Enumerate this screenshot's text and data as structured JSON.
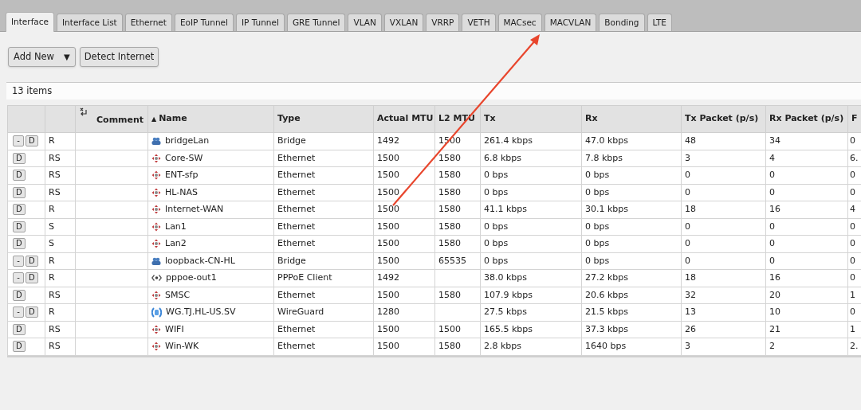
{
  "tabs": [
    {
      "label": "Interface",
      "selected": true
    },
    {
      "label": "Interface List",
      "selected": false
    },
    {
      "label": "Ethernet",
      "selected": false
    },
    {
      "label": "EoIP Tunnel",
      "selected": false
    },
    {
      "label": "IP Tunnel",
      "selected": false
    },
    {
      "label": "GRE Tunnel",
      "selected": false
    },
    {
      "label": "VLAN",
      "selected": false
    },
    {
      "label": "VXLAN",
      "selected": false
    },
    {
      "label": "VRRP",
      "selected": false
    },
    {
      "label": "VETH",
      "selected": false
    },
    {
      "label": "MACsec",
      "selected": false
    },
    {
      "label": "MACVLAN",
      "selected": false
    },
    {
      "label": "Bonding",
      "selected": false
    },
    {
      "label": "LTE",
      "selected": false
    }
  ],
  "toolbar": {
    "add_button": {
      "label": "Add New",
      "caret": "▼"
    },
    "detect_button": {
      "label": "Detect Internet"
    }
  },
  "item_count": "13 items",
  "table": {
    "columns": [
      "",
      "",
      "Comment",
      "Name",
      "Type",
      "Actual MTU",
      "L2 MTU",
      "Tx",
      "Rx",
      "Tx Packet (p/s)",
      "Rx Packet (p/s)",
      "F"
    ],
    "sort_mark": "▲",
    "rows": [
      {
        "buttons": [
          "-",
          "D"
        ],
        "flags": "R",
        "comment": "",
        "kind": "bridge",
        "name": "bridgeLan",
        "type": "Bridge",
        "actual_mtu": "1492",
        "l2_mtu": "1500",
        "tx": "261.4 kbps",
        "rx": "47.0 kbps",
        "tx_packet": "48",
        "rx_packet": "34",
        "column_12": "0"
      },
      {
        "buttons": [
          "D"
        ],
        "flags": "RS",
        "kind": "ethernet",
        "name": "Core-SW",
        "type": "Ethernet",
        "actual_mtu": "1500",
        "l2_mtu": "1580",
        "tx": "6.8 kbps",
        "rx": "7.8 kbps",
        "tx_packet": "3",
        "rx_packet": "4",
        "column_12": "6."
      },
      {
        "buttons": [
          "D"
        ],
        "flags": "RS",
        "kind": "ethernet",
        "name": "ENT-sfp",
        "type": "Ethernet",
        "actual_mtu": "1500",
        "l2_mtu": "1580",
        "tx": "0 bps",
        "rx": "0 bps",
        "tx_packet": "0",
        "rx_packet": "0",
        "column_12": "0"
      },
      {
        "buttons": [
          "D"
        ],
        "flags": "RS",
        "kind": "ethernet",
        "name": "HL-NAS",
        "type": "Ethernet",
        "actual_mtu": "1500",
        "l2_mtu": "1580",
        "tx": "0 bps",
        "rx": "0 bps",
        "tx_packet": "0",
        "rx_packet": "0",
        "column_12": "0"
      },
      {
        "buttons": [
          "D"
        ],
        "flags": "R",
        "kind": "ethernet",
        "name": "Internet-WAN",
        "type": "Ethernet",
        "actual_mtu": "1500",
        "l2_mtu": "1580",
        "tx": "41.1 kbps",
        "rx": "30.1 kbps",
        "tx_packet": "18",
        "rx_packet": "16",
        "column_12": "4"
      },
      {
        "buttons": [
          "D"
        ],
        "flags": "S",
        "kind": "ethernet",
        "name": "Lan1",
        "type": "Ethernet",
        "actual_mtu": "1500",
        "l2_mtu": "1580",
        "tx": "0 bps",
        "rx": "0 bps",
        "tx_packet": "0",
        "rx_packet": "0",
        "column_12": "0"
      },
      {
        "buttons": [
          "D"
        ],
        "flags": "S",
        "kind": "ethernet",
        "name": "Lan2",
        "type": "Ethernet",
        "actual_mtu": "1500",
        "l2_mtu": "1580",
        "tx": "0 bps",
        "rx": "0 bps",
        "tx_packet": "0",
        "rx_packet": "0",
        "column_12": "0"
      },
      {
        "buttons": [
          "-",
          "D"
        ],
        "flags": "R",
        "kind": "bridge",
        "name": "loopback-CN-HL",
        "type": "Bridge",
        "actual_mtu": "1500",
        "l2_mtu": "65535",
        "tx": "0 bps",
        "rx": "0 bps",
        "tx_packet": "0",
        "rx_packet": "0",
        "column_12": "0"
      },
      {
        "buttons": [
          "-",
          "D"
        ],
        "flags": "R",
        "kind": "pppoe",
        "name": "pppoe-out1",
        "type": "PPPoE Client",
        "actual_mtu": "1492",
        "tx": "38.0 kbps",
        "rx": "27.2 kbps",
        "tx_packet": "18",
        "rx_packet": "16",
        "column_12": "0"
      },
      {
        "buttons": [
          "D"
        ],
        "flags": "RS",
        "kind": "ethernet",
        "name": "SMSC",
        "type": "Ethernet",
        "actual_mtu": "1500",
        "l2_mtu": "1580",
        "tx": "107.9 kbps",
        "rx": "20.6 kbps",
        "tx_packet": "32",
        "rx_packet": "20",
        "column_12": "1"
      },
      {
        "buttons": [
          "-",
          "D"
        ],
        "flags": "R",
        "kind": "wireguard",
        "name": "WG.TJ.HL-US.SV",
        "type": "WireGuard",
        "actual_mtu": "1280",
        "tx": "27.5 kbps",
        "rx": "21.5 kbps",
        "tx_packet": "13",
        "rx_packet": "10",
        "column_12": "0"
      },
      {
        "buttons": [
          "D"
        ],
        "flags": "RS",
        "kind": "ethernet",
        "name": "WIFI",
        "type": "Ethernet",
        "actual_mtu": "1500",
        "l2_mtu": "1500",
        "tx": "165.5 kbps",
        "rx": "37.3 kbps",
        "tx_packet": "26",
        "rx_packet": "21",
        "column_12": "1"
      },
      {
        "buttons": [
          "D"
        ],
        "flags": "RS",
        "kind": "ethernet",
        "name": "Win-WK",
        "type": "Ethernet",
        "actual_mtu": "1500",
        "l2_mtu": "1580",
        "tx": "2.8 kbps",
        "rx": "1640 bps",
        "tx_packet": "3",
        "rx_packet": "2",
        "column_12": "2."
      }
    ]
  }
}
